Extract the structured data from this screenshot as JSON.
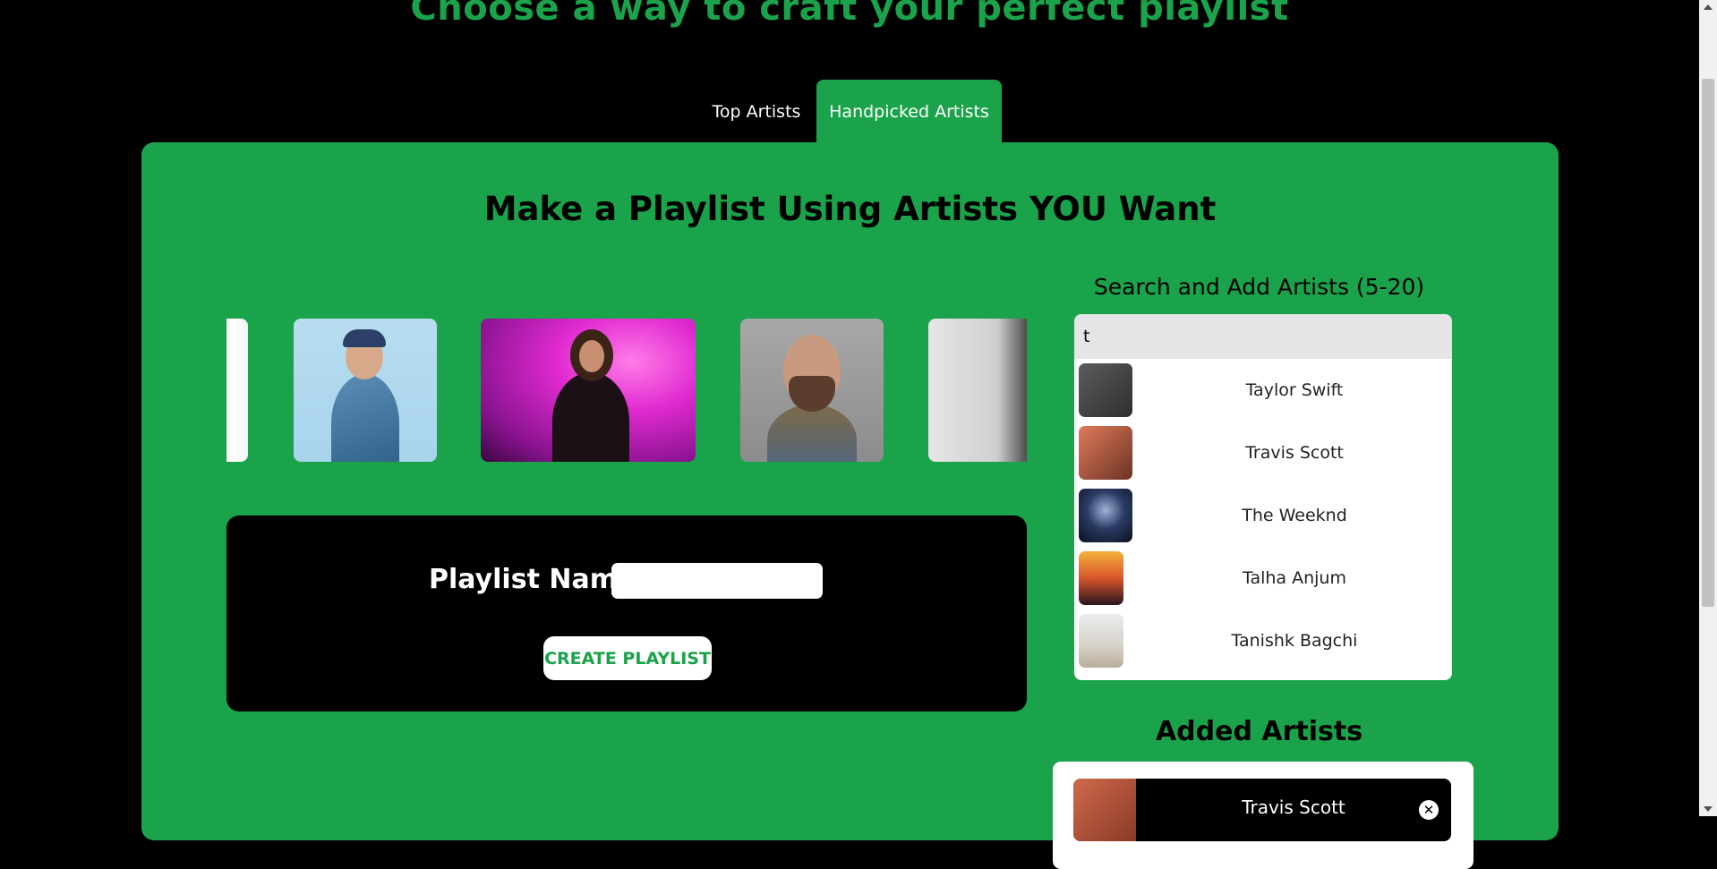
{
  "header": {
    "title": "Choose a way to craft your perfect playlist"
  },
  "tabs": [
    {
      "label": "Top Artists",
      "active": false
    },
    {
      "label": "Handpicked Artists",
      "active": true
    }
  ],
  "panel": {
    "title": "Make a Playlist Using Artists YOU Want"
  },
  "create": {
    "label": "Playlist Name:",
    "input_value": "",
    "button_label": "CREATE PLAYLIST"
  },
  "search": {
    "title": "Search and Add Artists (5-20)",
    "query": "t",
    "results": [
      {
        "name": "Taylor Swift"
      },
      {
        "name": "Travis Scott"
      },
      {
        "name": "The Weeknd"
      },
      {
        "name": "Talha Anjum"
      },
      {
        "name": "Tanishk Bagchi"
      }
    ]
  },
  "added": {
    "title": "Added Artists",
    "items": [
      {
        "name": "Travis Scott",
        "remove_icon": "close-icon"
      }
    ]
  },
  "colors": {
    "accent": "#1aa34a",
    "background": "#000000",
    "card": "#ffffff"
  }
}
